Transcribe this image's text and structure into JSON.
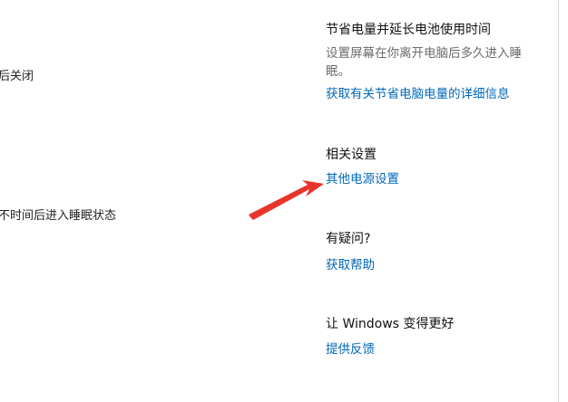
{
  "left": {
    "line1": "后关闭",
    "line2": "不时间后进入睡眠状态"
  },
  "power_tip": {
    "title": "节省电量并延长电池使用时间",
    "description": "设置屏幕在你离开电脑后多久进入睡眠。",
    "link": "获取有关节省电脑电量的详细信息"
  },
  "related": {
    "title": "相关设置",
    "link": "其他电源设置"
  },
  "help": {
    "title": "有疑问?",
    "link": "获取帮助"
  },
  "feedback": {
    "title": "让 Windows 变得更好",
    "link": "提供反馈"
  },
  "colors": {
    "link": "#0067b8",
    "arrow": "#e8352b"
  }
}
